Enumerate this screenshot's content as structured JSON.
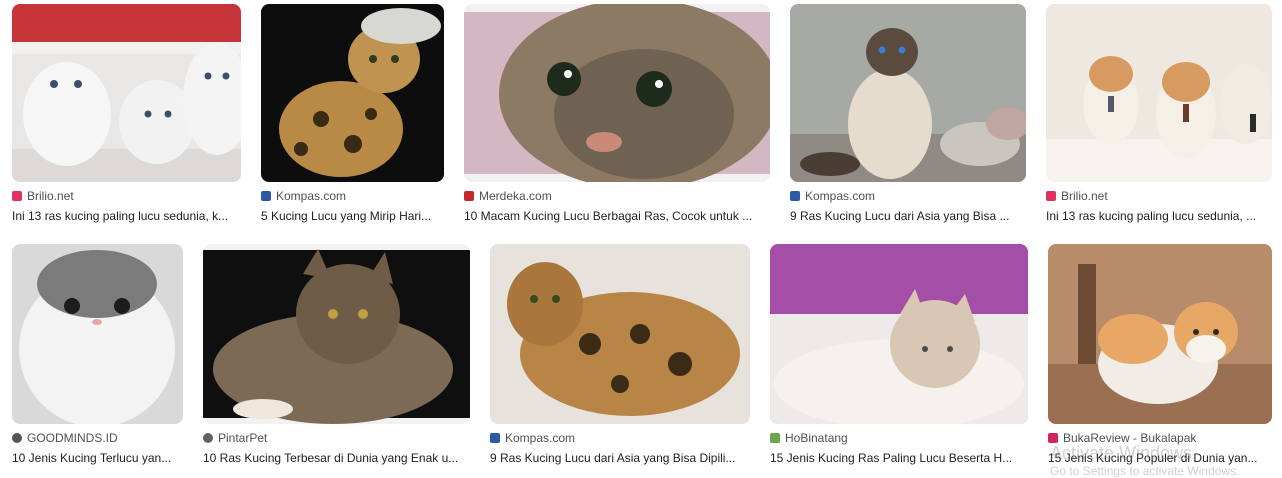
{
  "results": [
    {
      "source": "Brilio.net",
      "title": "Ini 13 ras kucing paling lucu sedunia, k...",
      "favicon_color": "#e0325f",
      "favicon_shape": "brilio-icon",
      "image": {
        "bg": "#e9e7e6",
        "accent": "#c7353b",
        "cat": "#f4f4f4",
        "desc": "three-white-kittens"
      }
    },
    {
      "source": "Kompas.com",
      "title": "5 Kucing Lucu yang Mirip Hari...",
      "favicon_color": "#2b5aa8",
      "favicon_shape": "kompas-icon",
      "image": {
        "bg": "#0d0d0d",
        "accent": "#3a2a14",
        "cat": "#b98a45",
        "desc": "bengal-cat-with-hat"
      }
    },
    {
      "source": "Merdeka.com",
      "title": "10 Macam Kucing Lucu Berbagai Ras, Cocok untuk ...",
      "favicon_color": "#c62828",
      "favicon_shape": "merdeka-icon",
      "image": {
        "bg": "#d5b6c3",
        "accent": "#8c7a64",
        "cat": "#6f6252",
        "desc": "tabby-cat-closeup"
      }
    },
    {
      "source": "Kompas.com",
      "title": "9 Ras Kucing Lucu dari Asia yang Bisa ...",
      "favicon_color": "#2b5aa8",
      "favicon_shape": "kompas-icon",
      "image": {
        "bg": "#a7a9a4",
        "accent": "#6b6e6a",
        "cat": "#e6dccd",
        "desc": "siamese-cat-on-rocks"
      }
    },
    {
      "source": "Brilio.net",
      "title": "Ini 13 ras kucing paling lucu sedunia, ...",
      "favicon_color": "#e0325f",
      "favicon_shape": "brilio-icon",
      "image": {
        "bg": "#efe8e1",
        "accent": "#d79a61",
        "cat": "#f5efe8",
        "desc": "exotic-kittens-with-ties"
      }
    },
    {
      "source": "GOODMINDS.ID",
      "title": "10 Jenis Kucing Terlucu yan...",
      "favicon_color": "#555555",
      "favicon_shape": "goodminds-icon",
      "image": {
        "bg": "#d9d9d9",
        "accent": "#7b7b7b",
        "cat": "#f3f3f3",
        "desc": "persian-grey-white-cat"
      }
    },
    {
      "source": "PintarPet",
      "title": "10 Ras Kucing Terbesar di Dunia yang Enak u...",
      "favicon_color": "#5f6368",
      "favicon_shape": "pintarpet-icon",
      "image": {
        "bg": "#0f0f0f",
        "accent": "#4a3a2a",
        "cat": "#7d6a55",
        "desc": "maine-coon-cat"
      }
    },
    {
      "source": "Kompas.com",
      "title": "9 Ras Kucing Lucu dari Asia yang Bisa Dipili...",
      "favicon_color": "#2b5aa8",
      "favicon_shape": "kompas-icon",
      "image": {
        "bg": "#e7e3dc",
        "accent": "#3b2a16",
        "cat": "#b88546",
        "desc": "bengal-cat-standing"
      }
    },
    {
      "source": "HoBinatang",
      "title": "15 Jenis Kucing Ras Paling Lucu Beserta H...",
      "favicon_color": "#6aa84f",
      "favicon_shape": "hobinatang-icon",
      "image": {
        "bg": "#a44ea8",
        "accent": "#eeeaea",
        "cat": "#d9c6b3",
        "desc": "kitten-on-blanket"
      }
    },
    {
      "source": "BukaReview - Bukalapak",
      "title": "15 Jenis Kucing Populer di Dunia yan...",
      "favicon_color": "#d1265a",
      "favicon_shape": "bukalapak-icon",
      "image": {
        "bg": "#b88b6a",
        "accent": "#6c4a33",
        "cat": "#e7a866",
        "desc": "munchkin-cat-walking"
      }
    }
  ],
  "overlay": {
    "line1": "Activate Windows",
    "line2": "Go to Settings to activate Windows."
  }
}
